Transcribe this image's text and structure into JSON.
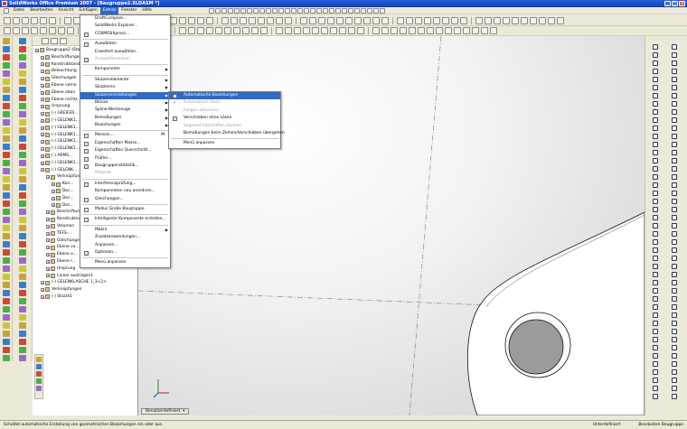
{
  "window": {
    "title": "SolidWorks Office Premium 2007 - [Baugruppe2.SLDASM *]"
  },
  "menubar": {
    "items": [
      "Datei",
      "Bearbeiten",
      "Ansicht",
      "Einfügen",
      "Extras",
      "Fenster",
      "Hilfe"
    ],
    "active_index": 4
  },
  "tools_menu": {
    "items": [
      {
        "label": "DraftCompare...",
        "type": "item"
      },
      {
        "label": "SolidWorks Explorer...",
        "type": "item"
      },
      {
        "label": "COSMOSXpress...",
        "type": "item",
        "icon": true
      },
      {
        "type": "sep"
      },
      {
        "label": "Auswählen",
        "type": "item",
        "icon": true
      },
      {
        "label": "Erweitert auswählen...",
        "type": "item"
      },
      {
        "label": "Auswahlbrandsen",
        "type": "item",
        "disabled": true,
        "icon": true
      },
      {
        "type": "sep"
      },
      {
        "label": "Komponente",
        "type": "item",
        "submenu": true
      },
      {
        "type": "sep"
      },
      {
        "label": "Skizzenelemente",
        "type": "item",
        "submenu": true
      },
      {
        "label": "Skizzieren",
        "type": "item",
        "submenu": true
      },
      {
        "label": "Skizzeneinstellungen",
        "type": "item",
        "submenu": true,
        "highlighted": true
      },
      {
        "label": "Blöcke",
        "type": "item",
        "submenu": true
      },
      {
        "label": "Spline-Werkzeuge",
        "type": "item",
        "submenu": true
      },
      {
        "label": "Bemaßungen",
        "type": "item",
        "submenu": true
      },
      {
        "label": "Beziehungen",
        "type": "item",
        "submenu": true
      },
      {
        "type": "sep"
      },
      {
        "label": "Messen...",
        "type": "item",
        "icon": true,
        "key": "M"
      },
      {
        "label": "Eigenschaften Masse...",
        "type": "item",
        "icon": true
      },
      {
        "label": "Eigenschaften Querschnitt...",
        "type": "item",
        "icon": true
      },
      {
        "label": "Prüfen...",
        "type": "item",
        "icon": true
      },
      {
        "label": "Baugruppenstatistik...",
        "type": "item",
        "icon": true
      },
      {
        "label": "Material",
        "type": "item",
        "disabled": true
      },
      {
        "type": "sep"
      },
      {
        "label": "Interferenzprüfung...",
        "type": "item",
        "icon": true
      },
      {
        "label": "Komponenten neu anordnen...",
        "type": "item"
      },
      {
        "label": "Gleichungen...",
        "type": "item",
        "icon": true
      },
      {
        "type": "sep"
      },
      {
        "label": "Modus Große Baugruppe",
        "type": "item",
        "icon": true
      },
      {
        "type": "sep"
      },
      {
        "label": "Intelligente Komponente erstellen...",
        "type": "item",
        "icon": true
      },
      {
        "type": "sep"
      },
      {
        "label": "Makro",
        "type": "item",
        "submenu": true
      },
      {
        "label": "Zusatzanwendungen...",
        "type": "item"
      },
      {
        "label": "Anpassen...",
        "type": "item"
      },
      {
        "label": "Optionen...",
        "type": "item",
        "icon": true
      },
      {
        "type": "sep"
      },
      {
        "label": "Menü anpassen",
        "type": "item"
      }
    ]
  },
  "submenu": {
    "items": [
      {
        "label": "Automatische Beziehungen",
        "icon": true,
        "highlighted": true
      },
      {
        "label": "Automatisch lösen",
        "disabled": true,
        "check": true
      },
      {
        "label": "Fangen aktivieren",
        "disabled": true
      },
      {
        "label": "Verschieben ohne Lösen",
        "icon": true
      },
      {
        "label": "Segment beschriften löschen",
        "disabled": true
      },
      {
        "label": "Bemaßungen beim Ziehen/Verschieben übergehen"
      },
      {
        "type": "sep"
      },
      {
        "label": "Menü anpassen"
      }
    ]
  },
  "tree": {
    "nodes": [
      {
        "label": "Baugruppe2 (Standard<Standard_An...",
        "indent": 0
      },
      {
        "label": "Beschriftungen",
        "indent": 1
      },
      {
        "label": "Konstruktionsbibliothek",
        "indent": 1
      },
      {
        "label": "Beleuchtung",
        "indent": 1
      },
      {
        "label": "Gleichungen",
        "indent": 1
      },
      {
        "label": "Ebene vorne",
        "indent": 1
      },
      {
        "label": "Ebene oben",
        "indent": 1
      },
      {
        "label": "Ebene rechts",
        "indent": 1
      },
      {
        "label": "Ursprung",
        "indent": 1
      },
      {
        "label": "(-) GREIFER...",
        "indent": 1
      },
      {
        "label": "(-) GELENK1...",
        "indent": 1
      },
      {
        "label": "(-) GELENK1...",
        "indent": 1
      },
      {
        "label": "(-) GELENK1...",
        "indent": 1
      },
      {
        "label": "(-) GELENK1...",
        "indent": 1
      },
      {
        "label": "(-) GELENK1...",
        "indent": 1
      },
      {
        "label": "(-) ARMS...",
        "indent": 1
      },
      {
        "label": "(-) GELENK1...",
        "indent": 1
      },
      {
        "label": "(-) GELENK...",
        "indent": 1
      },
      {
        "label": "Verknüpfungen",
        "indent": 2
      },
      {
        "label": "Kon...",
        "indent": 3
      },
      {
        "label": "Dec...",
        "indent": 3
      },
      {
        "label": "Dec...",
        "indent": 3
      },
      {
        "label": "Dec...",
        "indent": 3
      },
      {
        "label": "Beschriftungen",
        "indent": 2
      },
      {
        "label": "Konstruktion",
        "indent": 2
      },
      {
        "label": "Volumen",
        "indent": 2
      },
      {
        "label": "TEFS-...",
        "indent": 2
      },
      {
        "label": "Gleichungen",
        "indent": 2
      },
      {
        "label": "Ebene vo...",
        "indent": 2
      },
      {
        "label": "Ebene o...",
        "indent": 2
      },
      {
        "label": "Ebene r...",
        "indent": 2
      },
      {
        "label": "Ursprung",
        "indent": 2
      },
      {
        "label": "Linear austragen1",
        "indent": 2
      },
      {
        "label": "(-) GELENKLASCHE 1_3<2>",
        "indent": 1
      },
      {
        "label": "Verknüpfungen",
        "indent": 1
      },
      {
        "label": "(-) Skizze1",
        "indent": 1
      }
    ]
  },
  "viewport": {
    "tab_label": "Benutzerdefiniert"
  },
  "statusbar": {
    "message": "Schaltet automatische Erstellung von geometrischen Beziehungen ein oder aus.",
    "state": "Unterdefiniert",
    "mode": "Bearbeiten Baugruppe"
  }
}
